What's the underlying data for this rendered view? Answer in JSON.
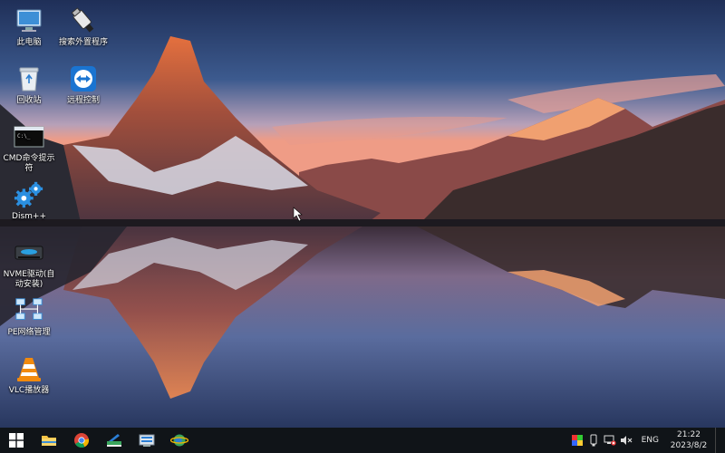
{
  "desktop": {
    "icons": [
      {
        "name": "this-pc",
        "label": "此电脑",
        "icon": "computer-icon"
      },
      {
        "name": "search-peripheral",
        "label": "搜索外置程序",
        "icon": "usb-drive-icon"
      },
      {
        "name": "recycle-bin",
        "label": "回收站",
        "icon": "recycle-bin-icon"
      },
      {
        "name": "remote-control",
        "label": "远程控制",
        "icon": "teamviewer-icon"
      },
      {
        "name": "cmd",
        "label": "CMD命令提示符",
        "icon": "terminal-icon"
      },
      {
        "name": "dism",
        "label": "Dism++",
        "icon": "gears-icon"
      },
      {
        "name": "nvme",
        "label": "NVME驱动(自动安装)",
        "icon": "drive-icon"
      },
      {
        "name": "pe-network",
        "label": "PE网络管理",
        "icon": "network-icon"
      },
      {
        "name": "vlc",
        "label": "VLC播放器",
        "icon": "vlc-cone-icon"
      }
    ]
  },
  "taskbar": {
    "apps": [
      "start-icon",
      "file-explorer-icon",
      "chrome-icon",
      "tool-icon",
      "disk-tool-icon",
      "globe-icon"
    ],
    "tray": {
      "language": "ENG",
      "time": "21:22",
      "date": "2023/8/2"
    }
  },
  "colors": {
    "taskbar_bg": "#101418",
    "start_blue": "#1d8ce0",
    "sky_top": "#26355f",
    "sunset_glow": "#e89a8a"
  }
}
